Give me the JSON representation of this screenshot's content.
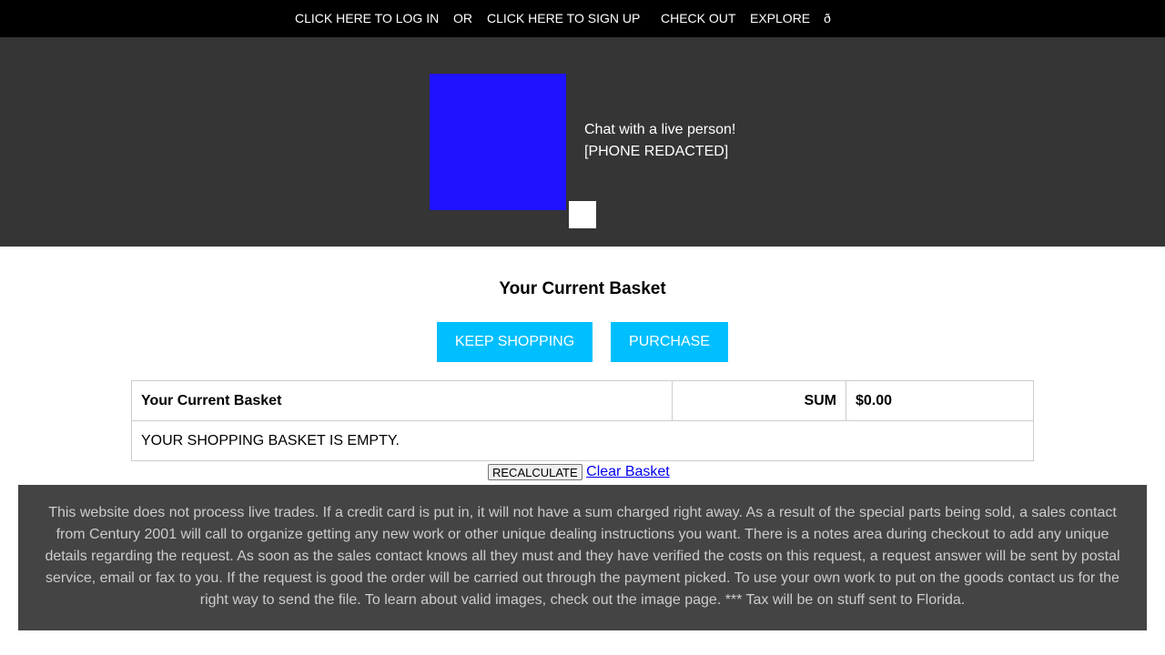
{
  "nav": {
    "login": "CLICK HERE TO LOG IN",
    "or": "OR",
    "signup": "CLICK HERE TO SIGN UP",
    "checkout": "CHECK OUT",
    "explore": "EXPLORE",
    "extra": "ð"
  },
  "hero": {
    "chat": "Chat with a live person!",
    "phone": "[PHONE REDACTED]"
  },
  "basket": {
    "title": "Your Current Basket",
    "keep_shopping": "KEEP SHOPPING",
    "purchase": "PURCHASE",
    "table": {
      "header_title": "Your Current Basket",
      "sum_label": "SUM",
      "sum_value": "$0.00",
      "empty_message": "YOUR SHOPPING BASKET IS EMPTY."
    },
    "recalculate": "RECALCULATE",
    "clear": "Clear Basket"
  },
  "notice": "This website does not process live trades. If a credit card is put in, it will not have a sum charged right away. As a result of the special parts being sold, a sales contact from Century 2001 will call to organize getting any new work or other unique dealing instructions you want. There is a notes area during checkout to add any unique details regarding the request. As soon as the sales contact knows all they must and they have verified the costs on this request, a request answer will be sent by postal service, email or fax to you. If the request is good the order will be carried out through the payment picked. To use your own work to put on the goods contact us for the right way to send the file. To learn about valid images, check out the image page. *** Tax will be on stuff sent to Florida.",
  "colors": {
    "nav_bg": "#000000",
    "hero_bg": "#353535",
    "logo": "#1e12ff",
    "button": "#00bfff",
    "notice_bg": "#444444"
  }
}
